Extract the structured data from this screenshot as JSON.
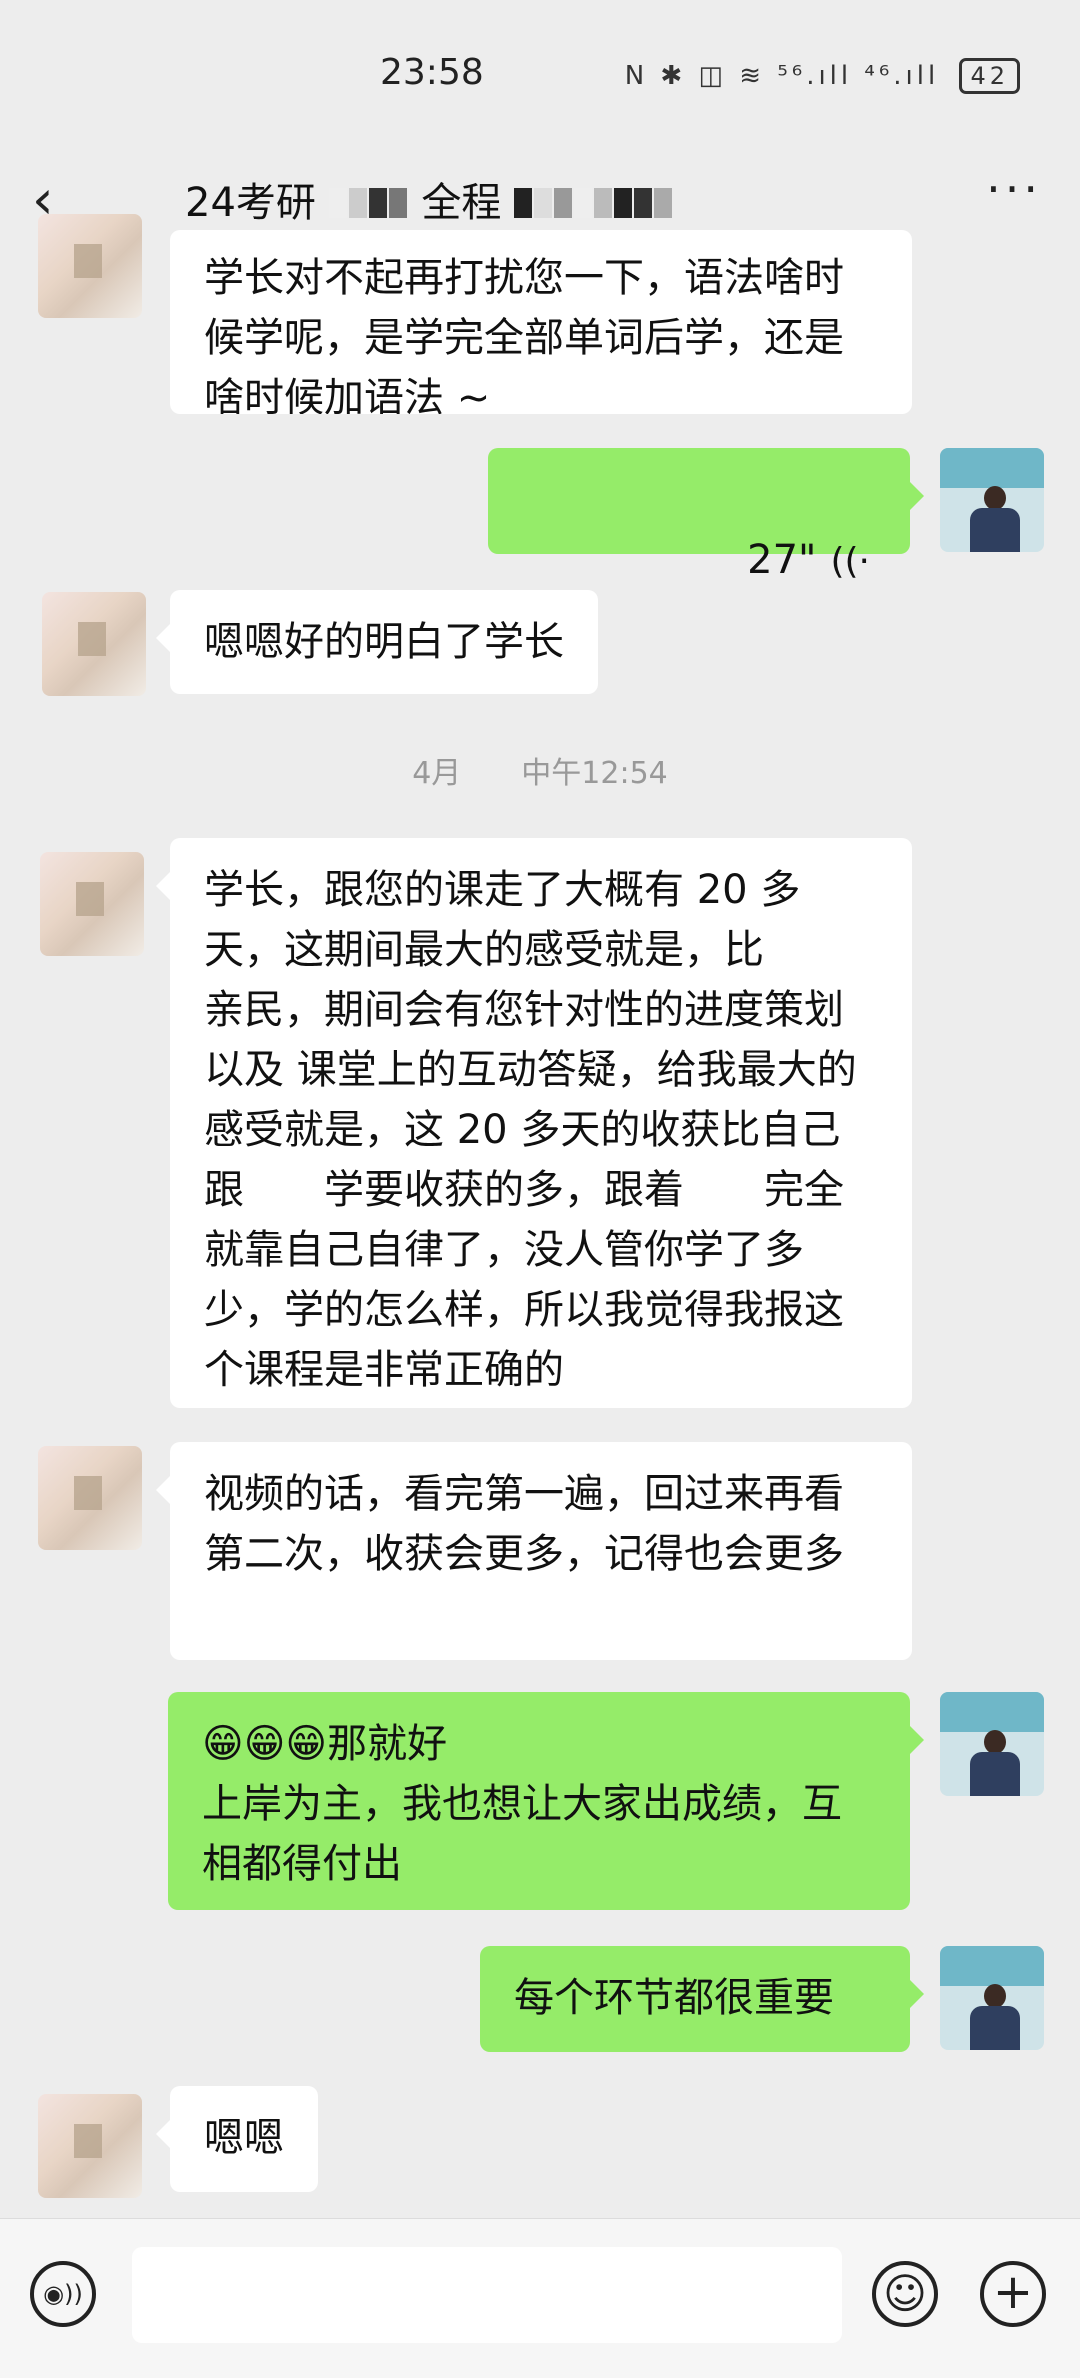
{
  "status": {
    "time": "23:58",
    "icons": "N ✱ ◫ ≋ ⁵⁶.ıll ⁴⁶.ıll",
    "battery": "42"
  },
  "nav": {
    "back": "‹",
    "title_a": "24考研",
    "title_b": "全程",
    "more": "···"
  },
  "messages": [
    {
      "side": "in",
      "text": "学长对不起再打扰您一下，语法啥时候学呢，是学完全部单词后学，还是啥时候加语法 ~"
    },
    {
      "side": "out",
      "type": "voice",
      "duration": "27\"",
      "wave": "((·"
    },
    {
      "side": "in",
      "text": "嗯嗯好的明白了学长"
    },
    {
      "side": "in",
      "text": "学长，跟您的课走了大概有 20 多天，这期间最大的感受就是，比　　亲民，期间会有您针对性的进度策划以及 课堂上的互动答疑，给我最大的感受就是，这 20 多天的收获比自己跟　　学要收获的多，跟着　　完全就靠自己自律了，没人管你学了多少，学的怎么样，所以我觉得我报这个课程是非常正确的"
    },
    {
      "side": "in",
      "text": "视频的话，看完第一遍，回过来再看第二次，收获会更多，记得也会更多"
    },
    {
      "side": "out",
      "text": "😁😁😁那就好\n上岸为主，我也想让大家出成绩，互相都得付出"
    },
    {
      "side": "out",
      "text": "每个环节都很重要"
    },
    {
      "side": "in",
      "text": "嗯嗯"
    }
  ],
  "timestamp": "4月　　中午12:54",
  "input": {
    "voice_icon": "◉))",
    "emoji_icon": "☺",
    "plus_icon": "+"
  },
  "colors": {
    "out_bubble": "#95ec69",
    "in_bubble": "#ffffff",
    "background": "#ededed"
  }
}
